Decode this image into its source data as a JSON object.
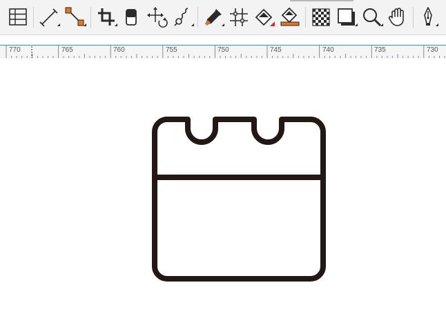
{
  "colors": {
    "toolbar_bg": "#f3f3f3",
    "icon_stroke": "#2a2a2a",
    "accent_orange": "#e6731e",
    "accent_red": "#e0262a",
    "ruler_border": "#1e9be0",
    "artwork_stroke": "#231815"
  },
  "toolbar": {
    "tools": [
      {
        "name": "table-icon"
      },
      {
        "name": "dimension-icon"
      },
      {
        "name": "connector-icon"
      },
      {
        "name": "crop-icon"
      },
      {
        "name": "eraser-icon"
      },
      {
        "name": "transform-icon"
      },
      {
        "name": "smear-icon"
      },
      {
        "name": "eyedropper-icon"
      },
      {
        "name": "snap-grid-icon"
      },
      {
        "name": "fill-icon"
      },
      {
        "name": "smart-fill-icon"
      },
      {
        "name": "transparency-icon"
      },
      {
        "name": "drop-shadow-icon"
      },
      {
        "name": "zoom-icon"
      },
      {
        "name": "pan-hand-icon"
      },
      {
        "name": "pen-icon"
      }
    ]
  },
  "ruler": {
    "labels": [
      "770",
      "765",
      "760",
      "755",
      "750",
      "745",
      "740",
      "735",
      "730"
    ]
  },
  "canvas": {
    "artwork": "calendar-outline-icon"
  }
}
